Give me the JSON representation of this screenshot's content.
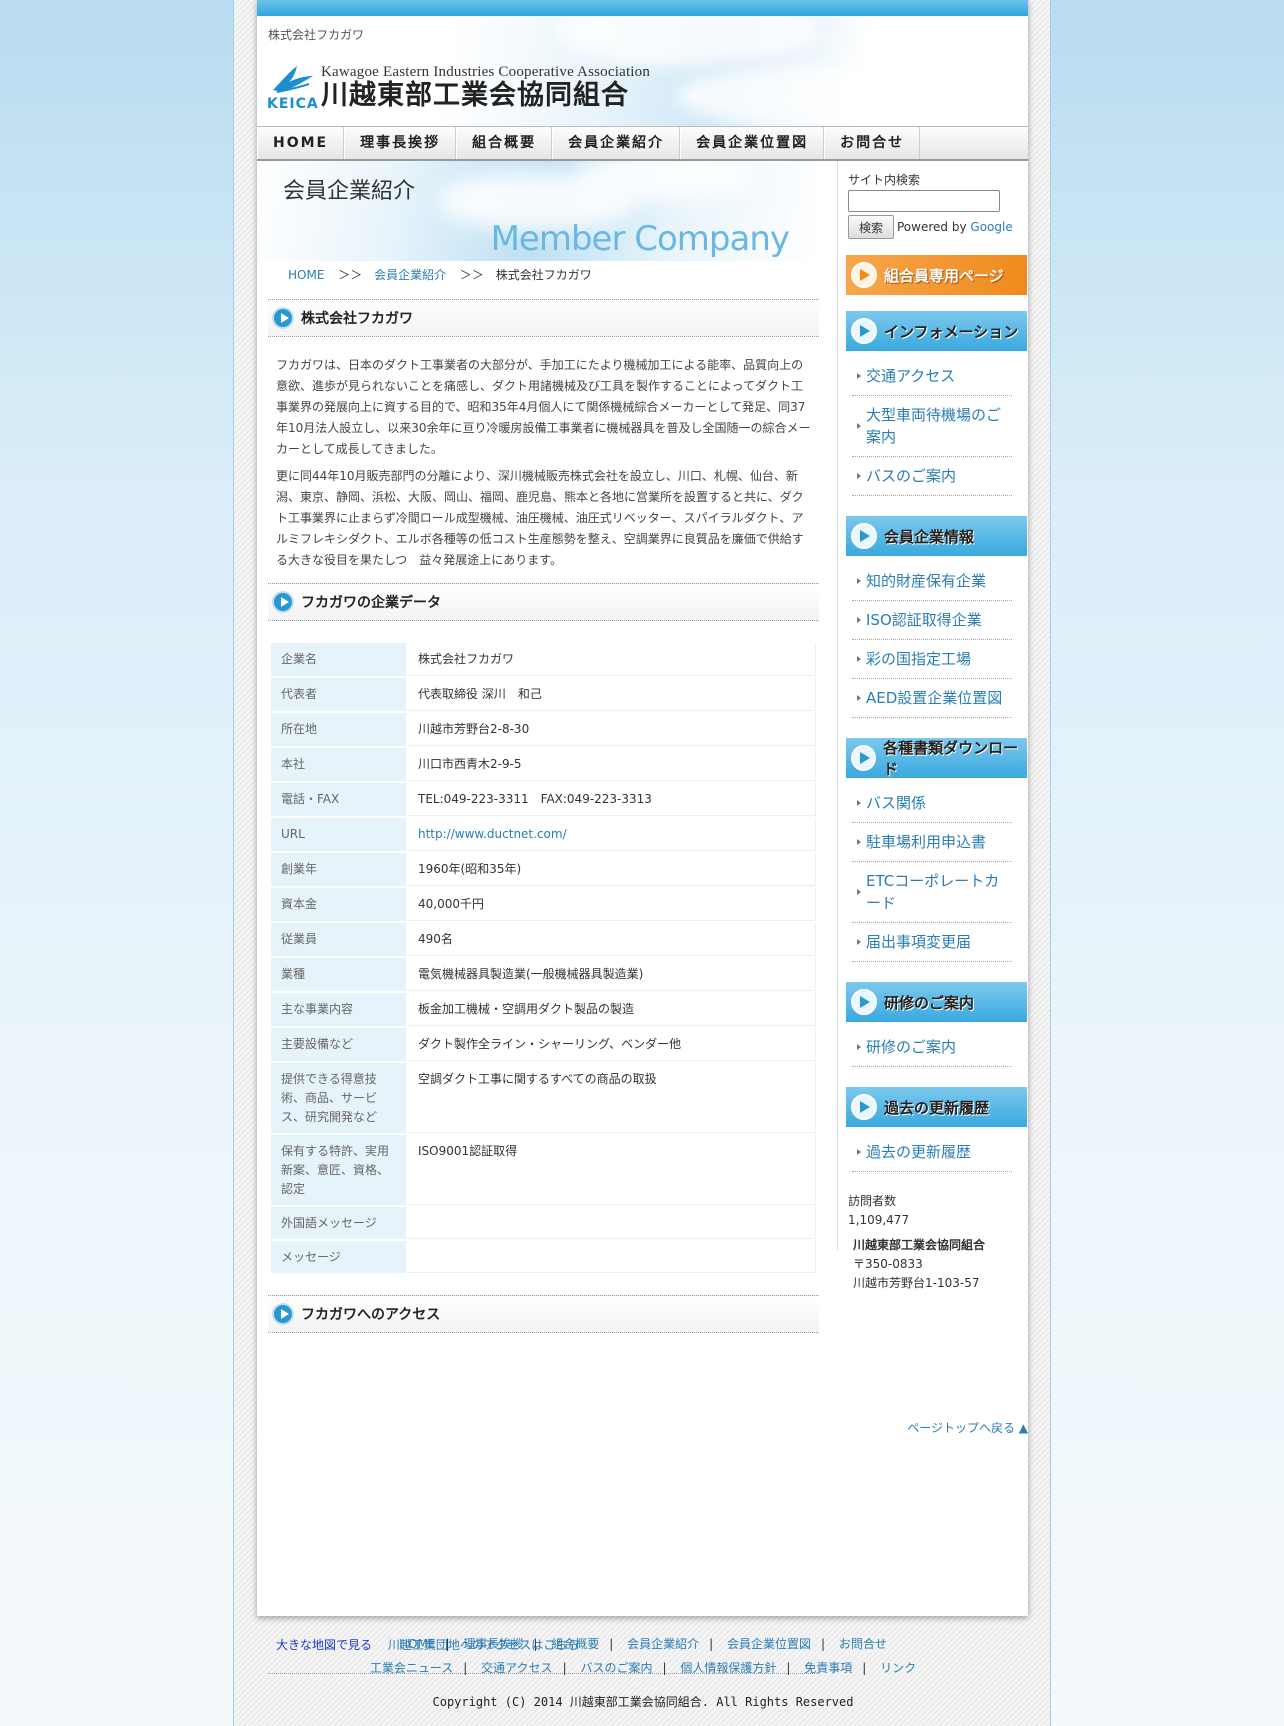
{
  "header": {
    "site_name": "株式会社フカガワ",
    "logo_abbr": "KEICA",
    "logo_en": "Kawagoe Eastern Industries Cooperative Association",
    "logo_jp": "川越東部工業会協同組合"
  },
  "nav": [
    "HOME",
    "理事長挨拶",
    "組合概要",
    "会員企業紹介",
    "会員企業位置図",
    "お問合せ"
  ],
  "banner": {
    "jp": "会員企業紹介",
    "en": "Member Company"
  },
  "breadcrumb": {
    "home": "HOME",
    "sep": "＞＞",
    "parent": "会員企業紹介",
    "current": "株式会社フカガワ"
  },
  "sections": {
    "company": "株式会社フカガワ",
    "data": "フカガワの企業データ",
    "access": "フカガワへのアクセス"
  },
  "intro": [
    "フカガワは、日本のダクト工事業者の大部分が、手加工にたより機械加工による能率、品質向上の意欲、進歩が見られないことを痛感し、ダクト用諸機械及び工具を製作することによってダクト工事業界の発展向上に資する目的で、昭和35年4月個人にて関係機械綜合メーカーとして発足、同37年10月法人設立し、以来30余年に亘り冷暖房設備工事業者に機械器具を普及し全国随一の綜合メーカーとして成長してきました。",
    "更に同44年10月販売部門の分離により、深川機械販売株式会社を設立し、川口、札幌、仙台、新潟、東京、静岡、浜松、大阪、岡山、福岡、鹿児島、熊本と各地に営業所を設置すると共に、ダクト工事業界に止まらず冷間ロール成型機械、油圧機械、油圧式リベッター、スパイラルダクト、アルミフレキシダクト、エルボ各種等の低コスト生産態勢を整え、空調業界に良質品を廉価で供給する大きな役目を果たしつ　益々発展途上にあります。"
  ],
  "table": [
    {
      "label": "企業名",
      "value": "株式会社フカガワ"
    },
    {
      "label": "代表者",
      "value": "代表取締役 深川　和己"
    },
    {
      "label": "所在地",
      "value": "川越市芳野台2-8-30"
    },
    {
      "label": "本社",
      "value": "川口市西青木2-9-5"
    },
    {
      "label": "電話・FAX",
      "value": "TEL:049-223-3311　FAX:049-223-3313"
    },
    {
      "label": "URL",
      "value": "http://www.ductnet.com/"
    },
    {
      "label": "創業年",
      "value": "1960年(昭和35年)"
    },
    {
      "label": "資本金",
      "value": "40,000千円"
    },
    {
      "label": "従業員",
      "value": "490名"
    },
    {
      "label": "業種",
      "value": "電気機械器具製造業(一般機械器具製造業)"
    },
    {
      "label": "主な事業内容",
      "value": "板金加工機械・空調用ダクト製品の製造"
    },
    {
      "label": "主要設備など",
      "value": "ダクト製作全ライン・シャーリング、ベンダー他"
    },
    {
      "label": "提供できる得意技術、商品、サービス、研究開発など",
      "value": "空調ダクト工事に関するすべての商品の取扱"
    },
    {
      "label": "保有する特許、実用新案、意匠、資格、認定",
      "value": "ISO9001認証取得"
    },
    {
      "label": "外国語メッセージ",
      "value": ""
    },
    {
      "label": "メッセージ",
      "value": ""
    }
  ],
  "maplinks": {
    "big": "大きな地図で見る",
    "access": "川越工業団地へのアクセスはこちら"
  },
  "pagetop": "ページトップへ戻る ▲",
  "side": {
    "search_label": "サイト内検索",
    "search_button": "検索",
    "powered_by": "Powered by",
    "google": "Google",
    "member_banner": "組合員専用ページ",
    "groups": [
      {
        "title": "インフォメーション",
        "items": [
          "交通アクセス",
          "大型車両待機場のご案内",
          "バスのご案内"
        ]
      },
      {
        "title": "会員企業情報",
        "items": [
          "知的財産保有企業",
          "ISO認証取得企業",
          "彩の国指定工場",
          "AED設置企業位置図"
        ]
      },
      {
        "title": "各種書類ダウンロード",
        "items": [
          "バス関係",
          "駐車場利用申込書",
          "ETCコーポレートカード",
          "届出事項変更届"
        ]
      },
      {
        "title": "研修のご案内",
        "items": [
          "研修のご案内"
        ]
      },
      {
        "title": "過去の更新履歴",
        "items": [
          "過去の更新履歴"
        ]
      }
    ],
    "counter_label": "訪問者数",
    "counter_value": "1,109,477",
    "org": "川越東部工業会協同組合",
    "zip": "〒350-0833",
    "address": "川越市芳野台1-103-57"
  },
  "footer": {
    "row1": [
      "HOME",
      "理事長挨拶",
      "組合概要",
      "会員企業紹介",
      "会員企業位置図",
      "お問合せ"
    ],
    "row2": [
      "工業会ニュース",
      "交通アクセス",
      "バスのご案内",
      "個人情報保護方針",
      "免責事項",
      "リンク"
    ],
    "copyright": "Copyright (C) 2014 川越東部工業会協同組合. All Rights Reserved"
  }
}
